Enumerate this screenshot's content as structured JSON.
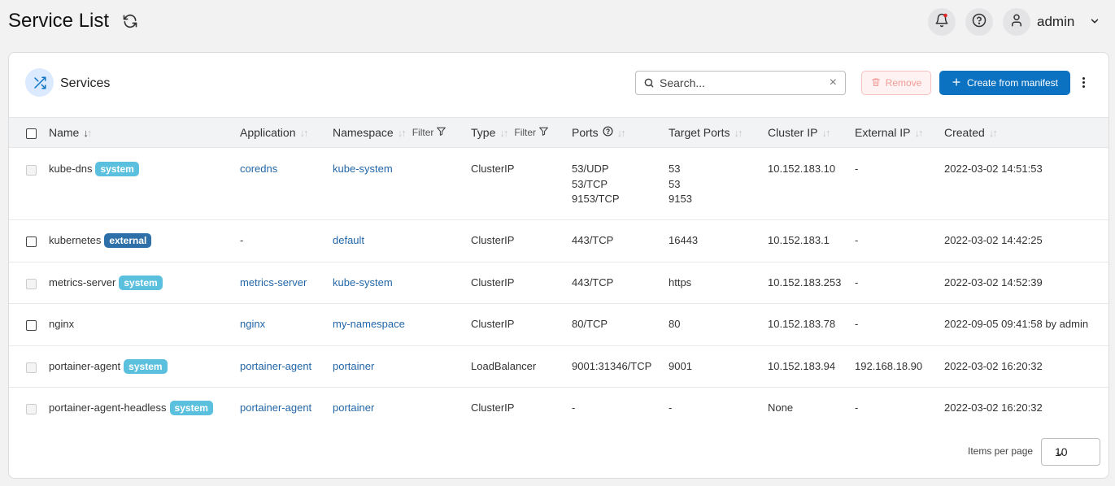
{
  "header": {
    "title": "Service List",
    "user": "admin"
  },
  "card": {
    "title": "Services",
    "search_placeholder": "Search...",
    "remove_label": "Remove",
    "create_label": "Create from manifest"
  },
  "columns": {
    "name": "Name",
    "application": "Application",
    "namespace": "Namespace",
    "type": "Type",
    "ports": "Ports",
    "target_ports": "Target Ports",
    "cluster_ip": "Cluster IP",
    "external_ip": "External IP",
    "created": "Created",
    "filter": "Filter"
  },
  "rows": [
    {
      "name": "kube-dns",
      "badge": "system",
      "application": "coredns",
      "namespace": "kube-system",
      "type": "ClusterIP",
      "ports": [
        "53/UDP",
        "53/TCP",
        "9153/TCP"
      ],
      "target_ports": [
        "53",
        "53",
        "9153"
      ],
      "cluster_ip": "10.152.183.10",
      "external_ip": "-",
      "created": "2022-03-02 14:51:53",
      "selectable": false
    },
    {
      "name": "kubernetes",
      "badge": "external",
      "application": "-",
      "namespace": "default",
      "type": "ClusterIP",
      "ports": [
        "443/TCP"
      ],
      "target_ports": [
        "16443"
      ],
      "cluster_ip": "10.152.183.1",
      "external_ip": "-",
      "created": "2022-03-02 14:42:25",
      "selectable": true
    },
    {
      "name": "metrics-server",
      "badge": "system",
      "application": "metrics-server",
      "namespace": "kube-system",
      "type": "ClusterIP",
      "ports": [
        "443/TCP"
      ],
      "target_ports": [
        "https"
      ],
      "cluster_ip": "10.152.183.253",
      "external_ip": "-",
      "created": "2022-03-02 14:52:39",
      "selectable": false
    },
    {
      "name": "nginx",
      "badge": "",
      "application": "nginx",
      "namespace": "my-namespace",
      "type": "ClusterIP",
      "ports": [
        "80/TCP"
      ],
      "target_ports": [
        "80"
      ],
      "cluster_ip": "10.152.183.78",
      "external_ip": "-",
      "created": "2022-09-05 09:41:58 by admin",
      "selectable": true
    },
    {
      "name": "portainer-agent",
      "badge": "system",
      "application": "portainer-agent",
      "namespace": "portainer",
      "type": "LoadBalancer",
      "ports": [
        "9001:31346/TCP"
      ],
      "target_ports": [
        "9001"
      ],
      "cluster_ip": "10.152.183.94",
      "external_ip": "192.168.18.90",
      "created": "2022-03-02 16:20:32",
      "selectable": false
    },
    {
      "name": "portainer-agent-headless",
      "badge": "system",
      "application": "portainer-agent",
      "namespace": "portainer",
      "type": "ClusterIP",
      "ports": [
        "-"
      ],
      "target_ports": [
        "-"
      ],
      "cluster_ip": "None",
      "external_ip": "-",
      "created": "2022-03-02 16:20:32",
      "selectable": false
    }
  ],
  "pagination": {
    "label": "Items per page",
    "value": "10"
  },
  "colors": {
    "primary": "#0b72c2",
    "link": "#2266a8",
    "badge_system": "#5bc0de",
    "badge_external": "#2d6fa8",
    "notification_dot": "#e02424"
  }
}
